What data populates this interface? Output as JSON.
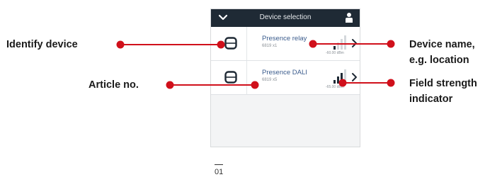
{
  "phone": {
    "title": "Device selection",
    "devices": [
      {
        "name": "Presence relay",
        "article": "6819 x1",
        "dbm": "-60.00 dBm",
        "signal_level": 1,
        "signal_max": 4
      },
      {
        "name": "Presence DALI",
        "article": "6819 x5",
        "dbm": "-65.00 dBm",
        "signal_level": 3,
        "signal_max": 4
      }
    ]
  },
  "callouts": {
    "identify_device": "Identify device",
    "article_no": "Article no.",
    "device_name_line1": "Device name,",
    "device_name_line2": "e.g. location",
    "field_strength_line1": "Field strength",
    "field_strength_line2": "indicator"
  },
  "figure": {
    "number": "01"
  },
  "colors": {
    "callout": "#d0101b",
    "topbar": "#1f2a35",
    "device_name": "#3a5b8c"
  }
}
